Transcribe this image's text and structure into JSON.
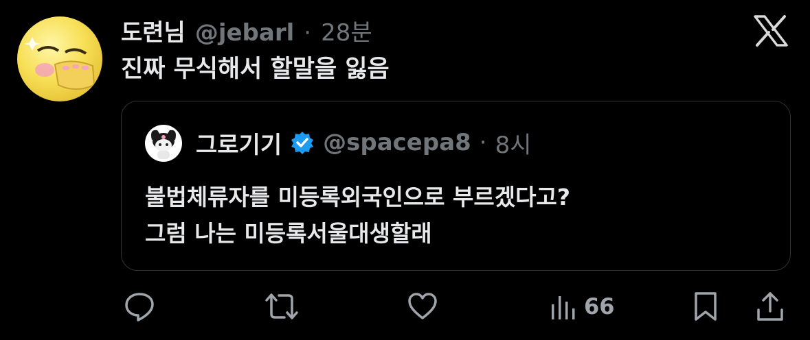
{
  "tweet": {
    "author_name": "도련님",
    "handle": "@jebarl",
    "separator": "·",
    "time": "28분",
    "text": "진짜 무식해서 할말을 잃음"
  },
  "quote": {
    "author_name": "그로기기",
    "handle": "@spacepa8",
    "separator": "·",
    "time": "8시",
    "verified": true,
    "lines": [
      "불법체류자를 미등록외국인으로 부르겠다고?",
      "그럼 나는 미등록서울대생할래"
    ]
  },
  "actions": {
    "reply_icon": "reply-icon",
    "repost_icon": "repost-icon",
    "like_icon": "like-icon",
    "views_icon": "views-icon",
    "views_count": "66",
    "bookmark_icon": "bookmark-icon",
    "share_icon": "share-icon"
  },
  "colors": {
    "background": "#000000",
    "text_primary": "#e7e9ea",
    "text_secondary": "#71767b",
    "border": "#2f3336",
    "verified_blue": "#1d9bf0"
  }
}
